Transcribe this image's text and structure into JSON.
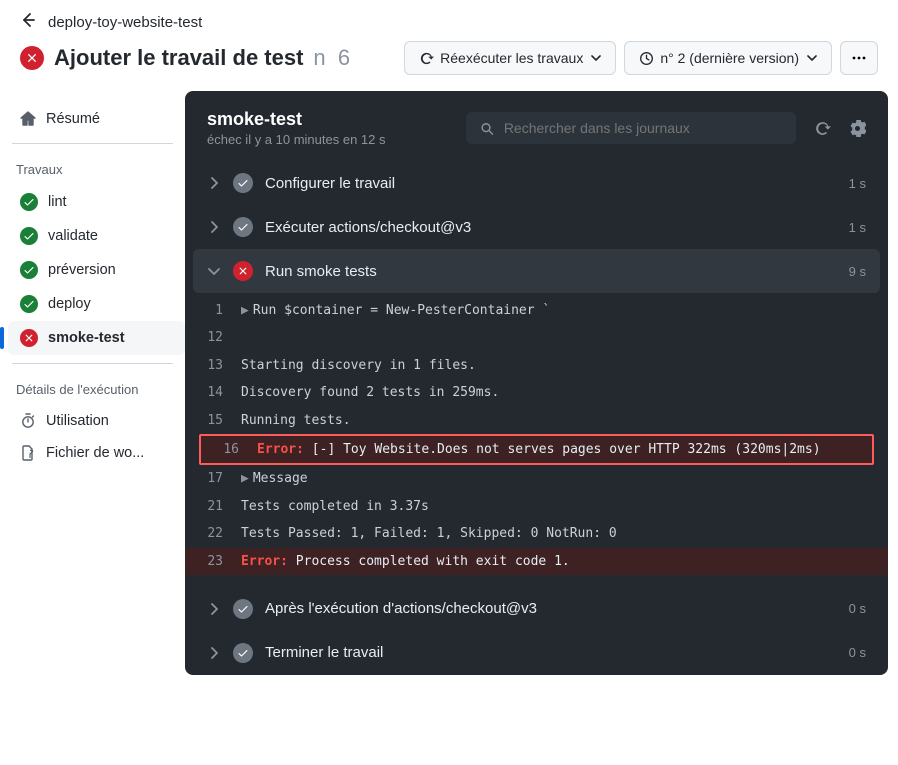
{
  "header": {
    "breadcrumb": "deploy-toy-website-test",
    "title": "Ajouter le travail de test",
    "run_prefix": "n",
    "run_number": "6",
    "rerun_label": "Réexécuter les travaux",
    "attempt_label": "n° 2 (dernière version)"
  },
  "sidebar": {
    "summary": "Résumé",
    "jobs_heading": "Travaux",
    "jobs": [
      {
        "name": "lint",
        "status": "success"
      },
      {
        "name": "validate",
        "status": "success"
      },
      {
        "name": "préversion",
        "status": "success"
      },
      {
        "name": "deploy",
        "status": "success"
      },
      {
        "name": "smoke-test",
        "status": "error"
      }
    ],
    "details_heading": "Détails de l'exécution",
    "usage": "Utilisation",
    "workflow_file": "Fichier de wo..."
  },
  "panel": {
    "title": "smoke-test",
    "subtitle": "échec il y a 10 minutes en 12 s",
    "search_placeholder": "Rechercher dans les journaux"
  },
  "steps": [
    {
      "name": "Configurer le travail",
      "duration": "1 s",
      "status": "success",
      "expanded": false
    },
    {
      "name": "Exécuter actions/checkout@v3",
      "duration": "1 s",
      "status": "success",
      "expanded": false
    },
    {
      "name": "Run smoke tests",
      "duration": "9 s",
      "status": "error",
      "expanded": true
    },
    {
      "name": "Après l'exécution d'actions/checkout@v3",
      "duration": "0 s",
      "status": "success",
      "expanded": false
    },
    {
      "name": "Terminer le travail",
      "duration": "0 s",
      "status": "success",
      "expanded": false
    }
  ],
  "log": {
    "lines": [
      {
        "n": "1",
        "collapsible": true,
        "text": "Run $container = New-PesterContainer `"
      },
      {
        "n": "12",
        "text": ""
      },
      {
        "n": "13",
        "text": "Starting discovery in 1 files."
      },
      {
        "n": "14",
        "text": "Discovery found 2 tests in 259ms."
      },
      {
        "n": "15",
        "text": "Running tests."
      },
      {
        "n": "16",
        "error": true,
        "highlight": true,
        "prefix": "Error:",
        "text": " [-] Toy Website.Does not serves pages over HTTP 322ms (320ms|2ms)"
      },
      {
        "n": "17",
        "collapsible": true,
        "text": "Message"
      },
      {
        "n": "21",
        "text": "Tests completed in 3.37s"
      },
      {
        "n": "22",
        "text": "Tests Passed: 1, Failed: 1, Skipped: 0 NotRun: 0"
      },
      {
        "n": "23",
        "error": true,
        "prefix": "Error:",
        "text": " Process completed with exit code 1."
      }
    ]
  }
}
